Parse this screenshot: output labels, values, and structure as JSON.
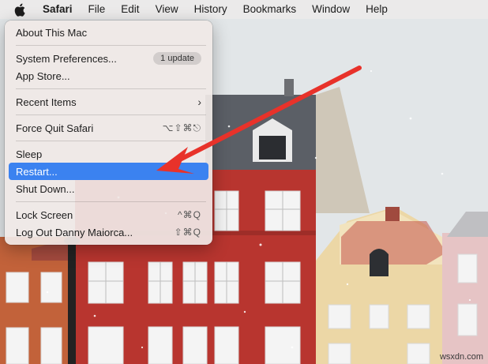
{
  "menubar": {
    "apple_icon": "apple-logo-icon",
    "items": [
      {
        "label": "Safari",
        "bold": true
      },
      {
        "label": "File"
      },
      {
        "label": "Edit"
      },
      {
        "label": "View"
      },
      {
        "label": "History"
      },
      {
        "label": "Bookmarks"
      },
      {
        "label": "Window"
      },
      {
        "label": "Help"
      }
    ]
  },
  "apple_menu": {
    "about": "About This Mac",
    "system_prefs": "System Preferences...",
    "system_prefs_badge": "1 update",
    "app_store": "App Store...",
    "recent_items": "Recent Items",
    "recent_items_chevron": "›",
    "force_quit": "Force Quit Safari",
    "force_quit_shortcut": "⌥⇧⌘⎋",
    "sleep": "Sleep",
    "restart": "Restart...",
    "shut_down": "Shut Down...",
    "lock_screen": "Lock Screen",
    "lock_screen_shortcut": "^⌘Q",
    "log_out": "Log Out Danny Maiorca...",
    "log_out_shortcut": "⇧⌘Q"
  },
  "annotation": {
    "arrow_color": "#e8322a",
    "points_to": "Restart..."
  },
  "highlight_color": "#3b82f0",
  "watermark": "wsxdn.com"
}
